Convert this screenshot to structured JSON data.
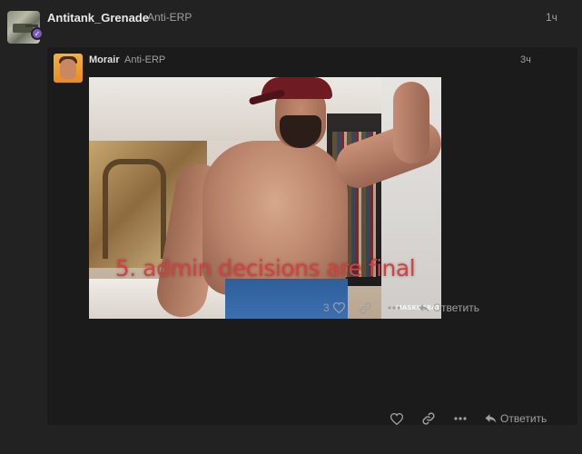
{
  "post": {
    "username": "Antitank_Grenade",
    "user_title": "Anti-ERP",
    "time": "1ч",
    "actions": {
      "reply_label": "Ответить"
    }
  },
  "quote": {
    "username": "Morair",
    "user_title": "Anti-ERP",
    "time": "3ч",
    "gif": {
      "caption": "5. admin decisions are final",
      "watermark": "MASKURBATE"
    },
    "actions": {
      "like_count": "3",
      "reply_label": "Ответить"
    }
  },
  "colors": {
    "background": "#222222",
    "quote_background": "#1b1b1b",
    "caption_red": "#d8403f",
    "flair_purple": "#7b5cc2"
  },
  "icons": [
    "heart-icon",
    "link-icon",
    "more-icon",
    "reply-icon"
  ]
}
